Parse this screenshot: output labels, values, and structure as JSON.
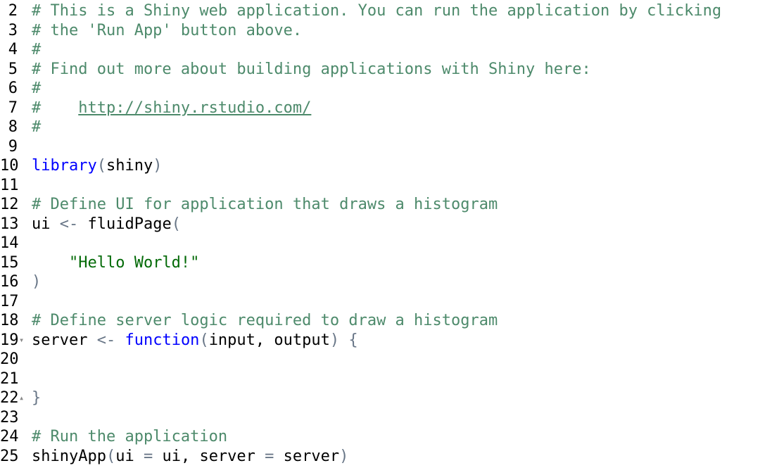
{
  "editor": {
    "language": "R",
    "lines": [
      {
        "number": "2",
        "fold": "",
        "tokens": [
          {
            "t": "# This is a Shiny web application. You can run the application by clicking",
            "c": "comment"
          }
        ]
      },
      {
        "number": "3",
        "fold": "",
        "tokens": [
          {
            "t": "# the 'Run App' button above.",
            "c": "comment"
          }
        ]
      },
      {
        "number": "4",
        "fold": "",
        "tokens": [
          {
            "t": "#",
            "c": "comment"
          }
        ]
      },
      {
        "number": "5",
        "fold": "",
        "tokens": [
          {
            "t": "# Find out more about building applications with Shiny here:",
            "c": "comment"
          }
        ]
      },
      {
        "number": "6",
        "fold": "",
        "tokens": [
          {
            "t": "#",
            "c": "comment"
          }
        ]
      },
      {
        "number": "7",
        "fold": "",
        "tokens": [
          {
            "t": "#    ",
            "c": "comment"
          },
          {
            "t": "http://shiny.rstudio.com/",
            "c": "link"
          }
        ]
      },
      {
        "number": "8",
        "fold": "",
        "tokens": [
          {
            "t": "#",
            "c": "comment"
          }
        ]
      },
      {
        "number": "9",
        "fold": "",
        "tokens": []
      },
      {
        "number": "10",
        "fold": "",
        "tokens": [
          {
            "t": "library",
            "c": "keyword"
          },
          {
            "t": "(",
            "c": "paren"
          },
          {
            "t": "shiny",
            "c": "default"
          },
          {
            "t": ")",
            "c": "paren"
          }
        ]
      },
      {
        "number": "11",
        "fold": "",
        "tokens": []
      },
      {
        "number": "12",
        "fold": "",
        "tokens": [
          {
            "t": "# Define UI for application that draws a histogram",
            "c": "comment"
          }
        ]
      },
      {
        "number": "13",
        "fold": "",
        "tokens": [
          {
            "t": "ui ",
            "c": "default"
          },
          {
            "t": "<-",
            "c": "op"
          },
          {
            "t": " fluidPage",
            "c": "default"
          },
          {
            "t": "(",
            "c": "paren"
          }
        ]
      },
      {
        "number": "14",
        "fold": "",
        "tokens": []
      },
      {
        "number": "15",
        "fold": "",
        "tokens": [
          {
            "t": "    ",
            "c": "default"
          },
          {
            "t": "\"Hello World!\"",
            "c": "string"
          }
        ]
      },
      {
        "number": "16",
        "fold": "",
        "tokens": [
          {
            "t": ")",
            "c": "paren"
          }
        ]
      },
      {
        "number": "17",
        "fold": "",
        "tokens": []
      },
      {
        "number": "18",
        "fold": "",
        "tokens": [
          {
            "t": "# Define server logic required to draw a histogram",
            "c": "comment"
          }
        ]
      },
      {
        "number": "19",
        "fold": "open",
        "tokens": [
          {
            "t": "server ",
            "c": "default"
          },
          {
            "t": "<-",
            "c": "op"
          },
          {
            "t": " ",
            "c": "default"
          },
          {
            "t": "function",
            "c": "keyword"
          },
          {
            "t": "(",
            "c": "paren"
          },
          {
            "t": "input, output",
            "c": "default"
          },
          {
            "t": ")",
            "c": "paren"
          },
          {
            "t": " ",
            "c": "default"
          },
          {
            "t": "{",
            "c": "paren"
          }
        ]
      },
      {
        "number": "20",
        "fold": "",
        "tokens": []
      },
      {
        "number": "21",
        "fold": "",
        "tokens": []
      },
      {
        "number": "22",
        "fold": "close",
        "tokens": [
          {
            "t": "}",
            "c": "paren"
          }
        ]
      },
      {
        "number": "23",
        "fold": "",
        "tokens": []
      },
      {
        "number": "24",
        "fold": "",
        "tokens": [
          {
            "t": "# Run the application",
            "c": "comment"
          }
        ]
      },
      {
        "number": "25",
        "fold": "",
        "tokens": [
          {
            "t": "shinyApp",
            "c": "default"
          },
          {
            "t": "(",
            "c": "paren"
          },
          {
            "t": "ui ",
            "c": "default"
          },
          {
            "t": "=",
            "c": "op"
          },
          {
            "t": " ui, server ",
            "c": "default"
          },
          {
            "t": "=",
            "c": "op"
          },
          {
            "t": " server",
            "c": "default"
          },
          {
            "t": ")",
            "c": "paren"
          }
        ]
      }
    ]
  },
  "colors": {
    "comment": "#4d8a6b",
    "keyword": "#0000ff",
    "string": "#036a07",
    "operator": "#687687",
    "text": "#000000",
    "background": "#ffffff"
  },
  "icons": {
    "fold_open": "fold-open-icon",
    "fold_close": "fold-close-icon"
  }
}
